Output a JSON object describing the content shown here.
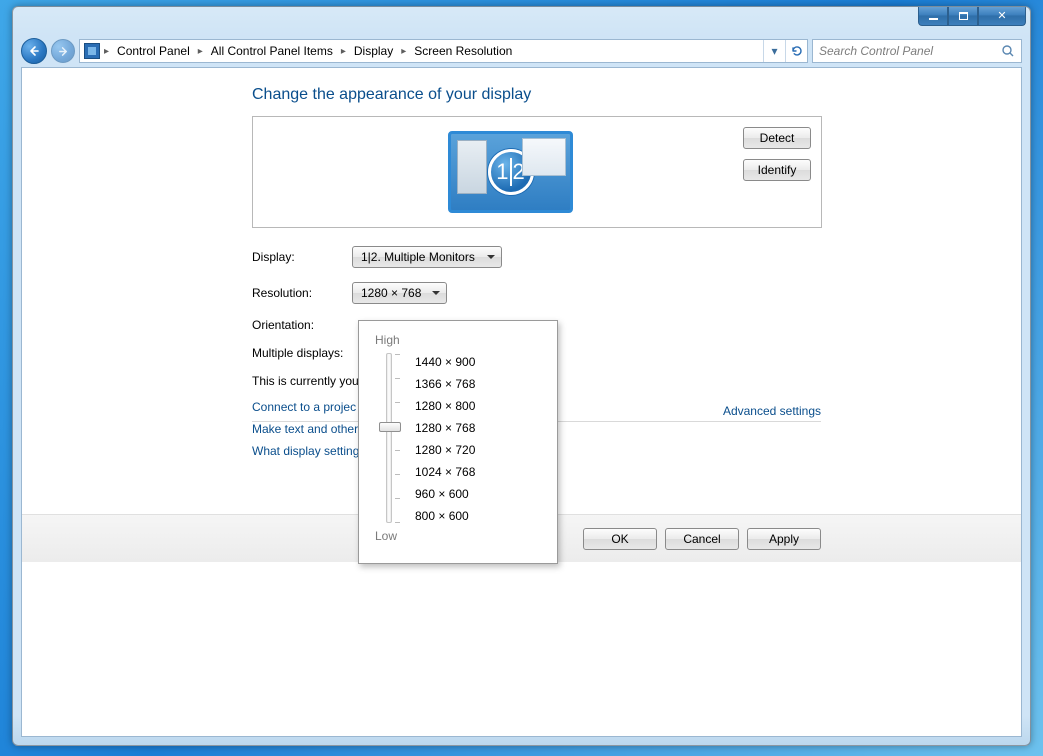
{
  "window_controls": {
    "min": "—",
    "max": "▢",
    "close": "✕"
  },
  "breadcrumb": {
    "items": [
      "Control Panel",
      "All Control Panel Items",
      "Display",
      "Screen Resolution"
    ]
  },
  "search": {
    "placeholder": "Search Control Panel"
  },
  "heading": "Change the appearance of your display",
  "preview": {
    "detect": "Detect",
    "identify": "Identify",
    "badge_left": "1",
    "badge_right": "2"
  },
  "form": {
    "display_label": "Display:",
    "display_value": "1|2. Multiple Monitors",
    "resolution_label": "Resolution:",
    "resolution_value": "1280 × 768",
    "orientation_label": "Orientation:",
    "multi_label": "Multiple displays:",
    "note": "This is currently you",
    "advanced": "Advanced settings"
  },
  "links": {
    "l1": "Connect to a projec",
    "l2": "Make text and other",
    "l3": "What display setting"
  },
  "footer": {
    "ok": "OK",
    "cancel": "Cancel",
    "apply": "Apply"
  },
  "res_popup": {
    "high": "High",
    "low": "Low",
    "options": [
      "1440 × 900",
      "1366 × 768",
      "1280 × 800",
      "1280 × 768",
      "1280 × 720",
      "1024 × 768",
      "960 × 600",
      "800 × 600"
    ]
  }
}
